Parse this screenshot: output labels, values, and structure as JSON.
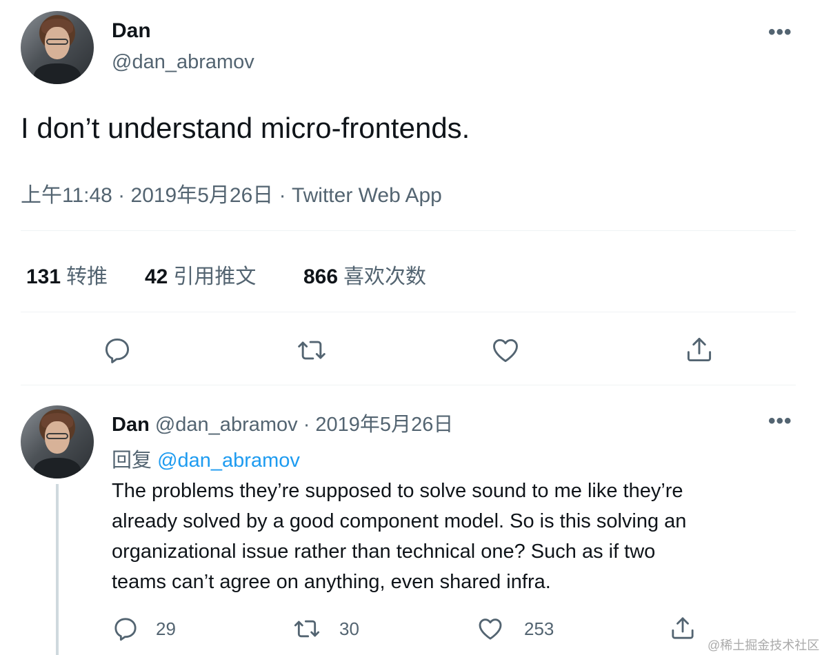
{
  "tweet": {
    "author_name": "Dan",
    "author_handle": "@dan_abramov",
    "more_label": "•••",
    "text": "I don’t understand micro-frontends.",
    "meta": "上午11:48 · 2019年5月26日 · Twitter Web App",
    "stats": [
      {
        "count": "131",
        "label": "转推"
      },
      {
        "count": "42",
        "label": "引用推文"
      },
      {
        "count": "866",
        "label": "喜欢次数"
      }
    ],
    "actions": [
      "reply-icon",
      "retweet-icon",
      "like-icon",
      "share-icon"
    ]
  },
  "reply": {
    "author_name": "Dan",
    "author_handle": "@dan_abramov",
    "separator": " · ",
    "date": "2019年5月26日",
    "more_label": "•••",
    "reply_to_label": "回复",
    "reply_to_handle": "@dan_abramov",
    "text_lines": [
      "The problems they’re supposed to solve sound to me like they’re",
      "already solved by a good component model. So is this solving an",
      "organizational issue rather than technical one? Such as if two",
      "teams can’t agree on anything, even shared infra."
    ],
    "counts": {
      "replies": "29",
      "retweets": "30",
      "likes": "253"
    }
  },
  "watermark": "@稀土掘金技术社区",
  "colors": {
    "accent": "#1d9bf0",
    "secondary_text": "#536471",
    "divider": "#eff3f4",
    "thread_line": "#cfd9de"
  }
}
